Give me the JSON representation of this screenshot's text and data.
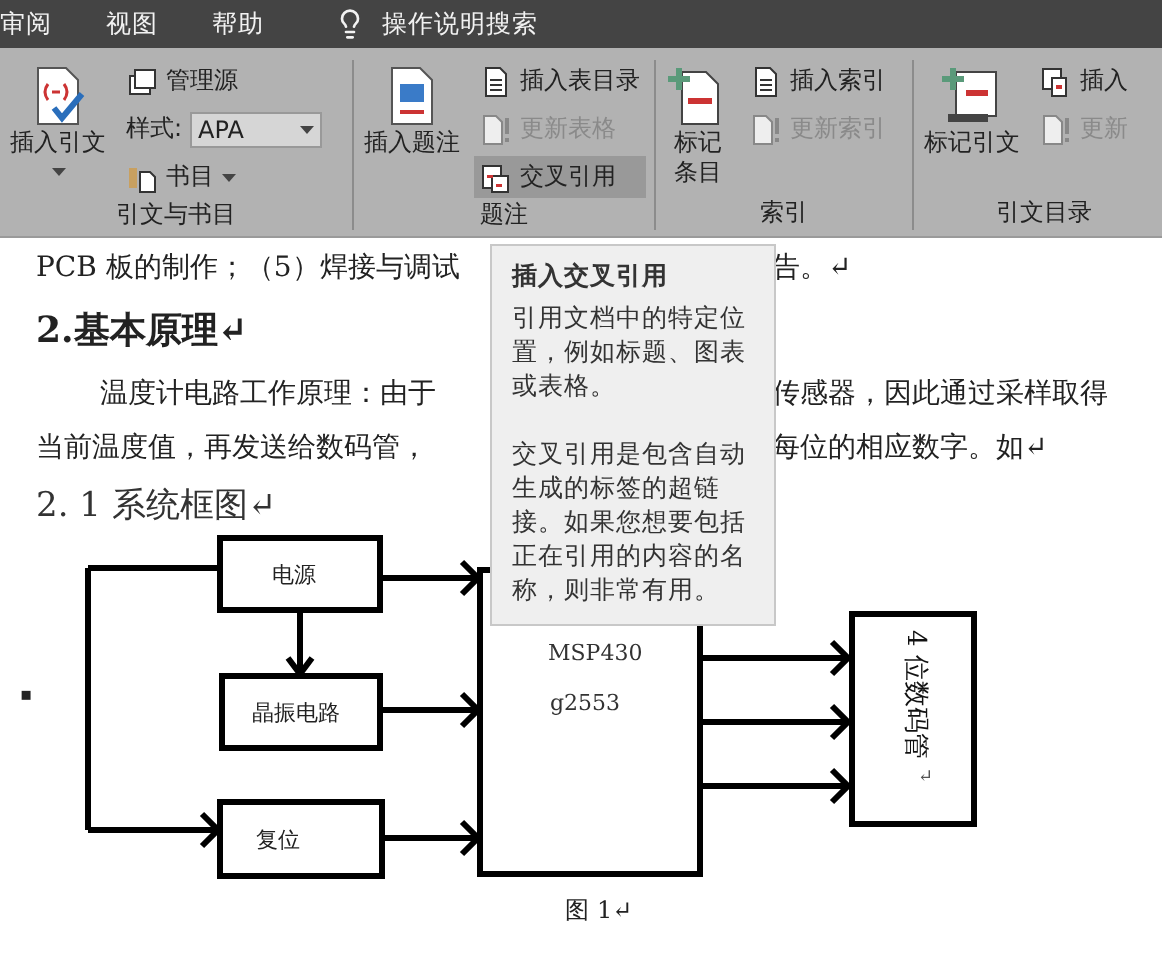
{
  "menu_bar": {
    "tabs": [
      {
        "label": "审阅"
      },
      {
        "label": "视图"
      },
      {
        "label": "帮助"
      }
    ],
    "search": {
      "label": "操作说明搜索"
    }
  },
  "ribbon": {
    "groups": [
      {
        "label": "引文与书目",
        "large": {
          "lines": [
            "插入引文"
          ],
          "has_menu": true
        },
        "small": [
          {
            "kind": "button",
            "label": "管理源",
            "disabled": false,
            "highlighted": false
          },
          {
            "kind": "dropdown",
            "label": "样式:",
            "value": "APA"
          },
          {
            "kind": "menu",
            "label": "书目",
            "disabled": false,
            "highlighted": false
          }
        ]
      },
      {
        "label": "题注",
        "large": {
          "lines": [
            "插入题注"
          ]
        },
        "small": [
          {
            "kind": "button",
            "label": "插入表目录",
            "disabled": false,
            "highlighted": false
          },
          {
            "kind": "button",
            "label": "更新表格",
            "disabled": true,
            "highlighted": false
          },
          {
            "kind": "button",
            "label": "交叉引用",
            "disabled": false,
            "highlighted": true
          }
        ]
      },
      {
        "label": "索引",
        "large": {
          "lines": [
            "标记",
            "条目"
          ]
        },
        "small": [
          {
            "kind": "button",
            "label": "插入索引",
            "disabled": false,
            "highlighted": false
          },
          {
            "kind": "button",
            "label": "更新索引",
            "disabled": true,
            "highlighted": false
          }
        ]
      },
      {
        "label": "引文目录",
        "large": {
          "lines": [
            "标记引文"
          ]
        },
        "small": [
          {
            "kind": "button",
            "label": "插入",
            "disabled": false,
            "highlighted": false
          },
          {
            "kind": "button",
            "label": "更新",
            "disabled": true,
            "highlighted": false
          }
        ]
      }
    ]
  },
  "document": {
    "lines": [
      {
        "kind": "split",
        "left": "PCB 板的制作；（5）焊接与调试",
        "right": "告。↵"
      },
      {
        "kind": "heading",
        "text": "2.基本原理↵"
      },
      {
        "kind": "split_indent",
        "left": "温度计电路工作原理：由于",
        "right": "传感器，因此通过采样取得"
      },
      {
        "kind": "split",
        "left": "当前温度值，再发送给数码管，",
        "right": "每位的相应数字。如↵"
      },
      {
        "kind": "subheading",
        "text": "2. 1 系统框图↵"
      }
    ],
    "anchor_mark": "▪",
    "figure": {
      "power": "电源",
      "oscillator": "晶振电路",
      "reset": "复位",
      "mcu": [
        "MSP430",
        "g2553"
      ],
      "display": "4 位数码管",
      "display_mark": "↵"
    },
    "caption": "图  1↵"
  },
  "tooltip": {
    "title": "插入交叉引用",
    "paragraphs": [
      "引用文档中的特定位置，例如标题、图表或表格。",
      "交叉引用是包含自动生成的标签的超链接。如果您想要包括正在引用的内容的名称，则非常有用。"
    ]
  }
}
